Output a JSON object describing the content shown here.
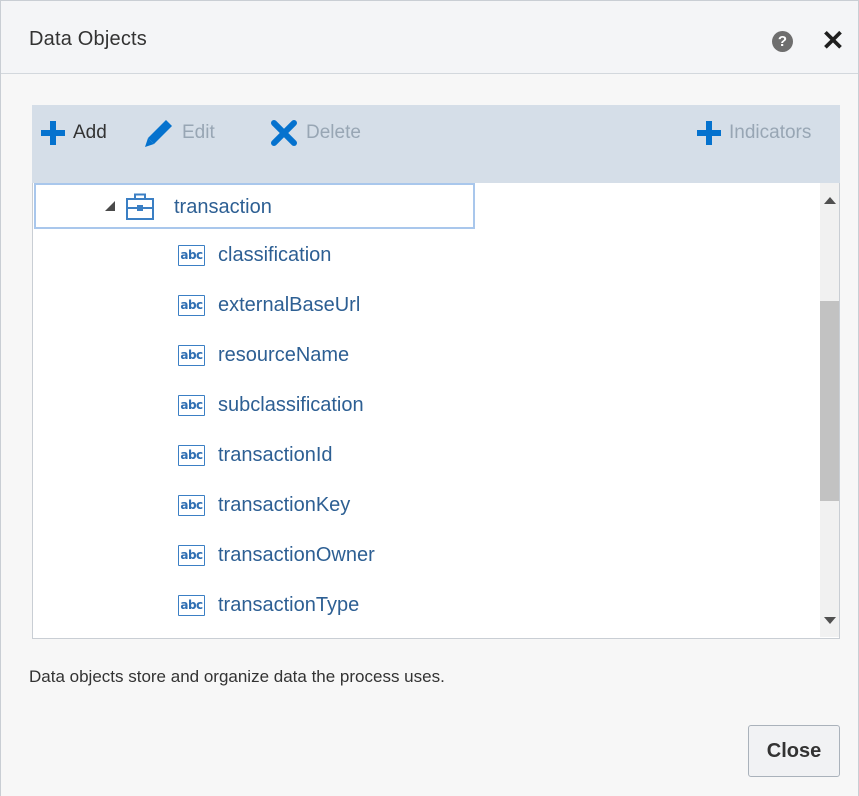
{
  "dialog": {
    "title": "Data Objects",
    "help_icon": "help-circle-icon",
    "close_icon": "close-icon"
  },
  "toolbar": {
    "add_label": "Add",
    "edit_label": "Edit",
    "delete_label": "Delete",
    "indicators_label": "Indicators"
  },
  "tree": {
    "parent": {
      "label": "transaction",
      "icon": "business-object-icon",
      "expanded": true
    },
    "children": [
      {
        "label": "classification",
        "icon_text": "abc"
      },
      {
        "label": "externalBaseUrl",
        "icon_text": "abc"
      },
      {
        "label": "resourceName",
        "icon_text": "abc"
      },
      {
        "label": "subclassification",
        "icon_text": "abc"
      },
      {
        "label": "transactionId",
        "icon_text": "abc"
      },
      {
        "label": "transactionKey",
        "icon_text": "abc"
      },
      {
        "label": "transactionOwner",
        "icon_text": "abc"
      },
      {
        "label": "transactionType",
        "icon_text": "abc"
      }
    ]
  },
  "footer": {
    "description": "Data objects store and organize data the process uses.",
    "close_button": "Close"
  },
  "colors": {
    "accent": "#0572ce",
    "toolbar_bg": "#d5dee8",
    "link_text": "#2d5f93",
    "disabled_text": "#98a6b4"
  }
}
